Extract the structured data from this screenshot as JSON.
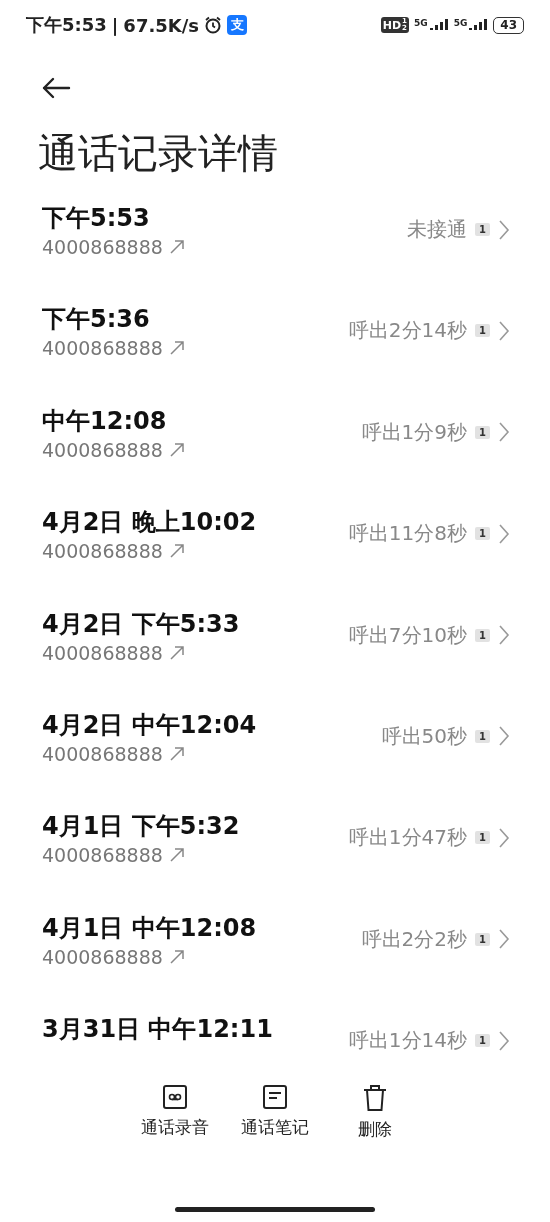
{
  "status_bar": {
    "time": "下午5:53",
    "separator": "|",
    "speed": "67.5K/s",
    "app_badge": "支",
    "hd": "HD",
    "hd_sub": [
      "1",
      "2"
    ],
    "signals": [
      {
        "label": "5G"
      },
      {
        "label": "5G"
      }
    ],
    "battery": "43"
  },
  "title": "通话记录详情",
  "calls": [
    {
      "time": "下午5:53",
      "number": "4000868888",
      "status": "未接通",
      "sim": "1"
    },
    {
      "time": "下午5:36",
      "number": "4000868888",
      "status": "呼出2分14秒",
      "sim": "1"
    },
    {
      "time": "中午12:08",
      "number": "4000868888",
      "status": "呼出1分9秒",
      "sim": "1"
    },
    {
      "time": "4月2日 晚上10:02",
      "number": "4000868888",
      "status": "呼出11分8秒",
      "sim": "1"
    },
    {
      "time": "4月2日 下午5:33",
      "number": "4000868888",
      "status": "呼出7分10秒",
      "sim": "1"
    },
    {
      "time": "4月2日 中午12:04",
      "number": "4000868888",
      "status": "呼出50秒",
      "sim": "1"
    },
    {
      "time": "4月1日 下午5:32",
      "number": "4000868888",
      "status": "呼出1分47秒",
      "sim": "1"
    },
    {
      "time": "4月1日 中午12:08",
      "number": "4000868888",
      "status": "呼出2分2秒",
      "sim": "1"
    },
    {
      "time": "3月31日 中午12:11",
      "status": "呼出1分14秒",
      "sim": "1"
    }
  ],
  "actions": [
    {
      "kind": "recording",
      "label": "通话录音"
    },
    {
      "kind": "notes",
      "label": "通话笔记"
    },
    {
      "kind": "delete",
      "label": "删除"
    }
  ]
}
